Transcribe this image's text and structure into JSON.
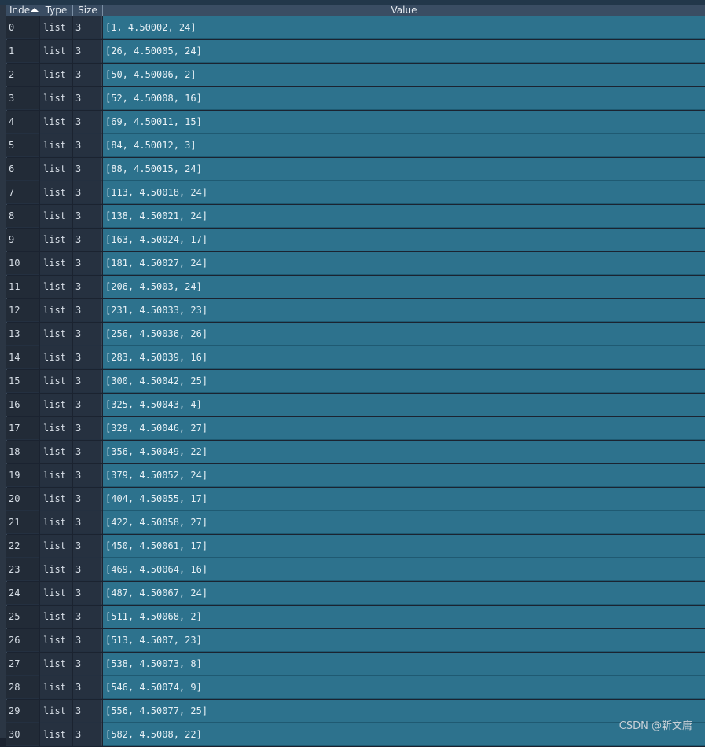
{
  "header": {
    "index": "Inde",
    "type": "Type",
    "size": "Size",
    "value": "Value"
  },
  "rows": [
    {
      "index": "0",
      "type": "list",
      "size": "3",
      "value": "[1, 4.50002, 24]"
    },
    {
      "index": "1",
      "type": "list",
      "size": "3",
      "value": "[26, 4.50005, 24]"
    },
    {
      "index": "2",
      "type": "list",
      "size": "3",
      "value": "[50, 4.50006, 2]"
    },
    {
      "index": "3",
      "type": "list",
      "size": "3",
      "value": "[52, 4.50008, 16]"
    },
    {
      "index": "4",
      "type": "list",
      "size": "3",
      "value": "[69, 4.50011, 15]"
    },
    {
      "index": "5",
      "type": "list",
      "size": "3",
      "value": "[84, 4.50012, 3]"
    },
    {
      "index": "6",
      "type": "list",
      "size": "3",
      "value": "[88, 4.50015, 24]"
    },
    {
      "index": "7",
      "type": "list",
      "size": "3",
      "value": "[113, 4.50018, 24]"
    },
    {
      "index": "8",
      "type": "list",
      "size": "3",
      "value": "[138, 4.50021, 24]"
    },
    {
      "index": "9",
      "type": "list",
      "size": "3",
      "value": "[163, 4.50024, 17]"
    },
    {
      "index": "10",
      "type": "list",
      "size": "3",
      "value": "[181, 4.50027, 24]"
    },
    {
      "index": "11",
      "type": "list",
      "size": "3",
      "value": "[206, 4.5003, 24]"
    },
    {
      "index": "12",
      "type": "list",
      "size": "3",
      "value": "[231, 4.50033, 23]"
    },
    {
      "index": "13",
      "type": "list",
      "size": "3",
      "value": "[256, 4.50036, 26]"
    },
    {
      "index": "14",
      "type": "list",
      "size": "3",
      "value": "[283, 4.50039, 16]"
    },
    {
      "index": "15",
      "type": "list",
      "size": "3",
      "value": "[300, 4.50042, 25]"
    },
    {
      "index": "16",
      "type": "list",
      "size": "3",
      "value": "[325, 4.50043, 4]"
    },
    {
      "index": "17",
      "type": "list",
      "size": "3",
      "value": "[329, 4.50046, 27]"
    },
    {
      "index": "18",
      "type": "list",
      "size": "3",
      "value": "[356, 4.50049, 22]"
    },
    {
      "index": "19",
      "type": "list",
      "size": "3",
      "value": "[379, 4.50052, 24]"
    },
    {
      "index": "20",
      "type": "list",
      "size": "3",
      "value": "[404, 4.50055, 17]"
    },
    {
      "index": "21",
      "type": "list",
      "size": "3",
      "value": "[422, 4.50058, 27]"
    },
    {
      "index": "22",
      "type": "list",
      "size": "3",
      "value": "[450, 4.50061, 17]"
    },
    {
      "index": "23",
      "type": "list",
      "size": "3",
      "value": "[469, 4.50064, 16]"
    },
    {
      "index": "24",
      "type": "list",
      "size": "3",
      "value": "[487, 4.50067, 24]"
    },
    {
      "index": "25",
      "type": "list",
      "size": "3",
      "value": "[511, 4.50068, 2]"
    },
    {
      "index": "26",
      "type": "list",
      "size": "3",
      "value": "[513, 4.5007, 23]"
    },
    {
      "index": "27",
      "type": "list",
      "size": "3",
      "value": "[538, 4.50073, 8]"
    },
    {
      "index": "28",
      "type": "list",
      "size": "3",
      "value": "[546, 4.50074, 9]"
    },
    {
      "index": "29",
      "type": "list",
      "size": "3",
      "value": "[556, 4.50077, 25]"
    },
    {
      "index": "30",
      "type": "list",
      "size": "3",
      "value": "[582, 4.5008, 22]"
    }
  ],
  "watermark": "CSDN @靳文庸",
  "colors": {
    "value_bg": "#2d728d",
    "index_bg": "#222b37",
    "header_bg": "#3a4d63"
  }
}
